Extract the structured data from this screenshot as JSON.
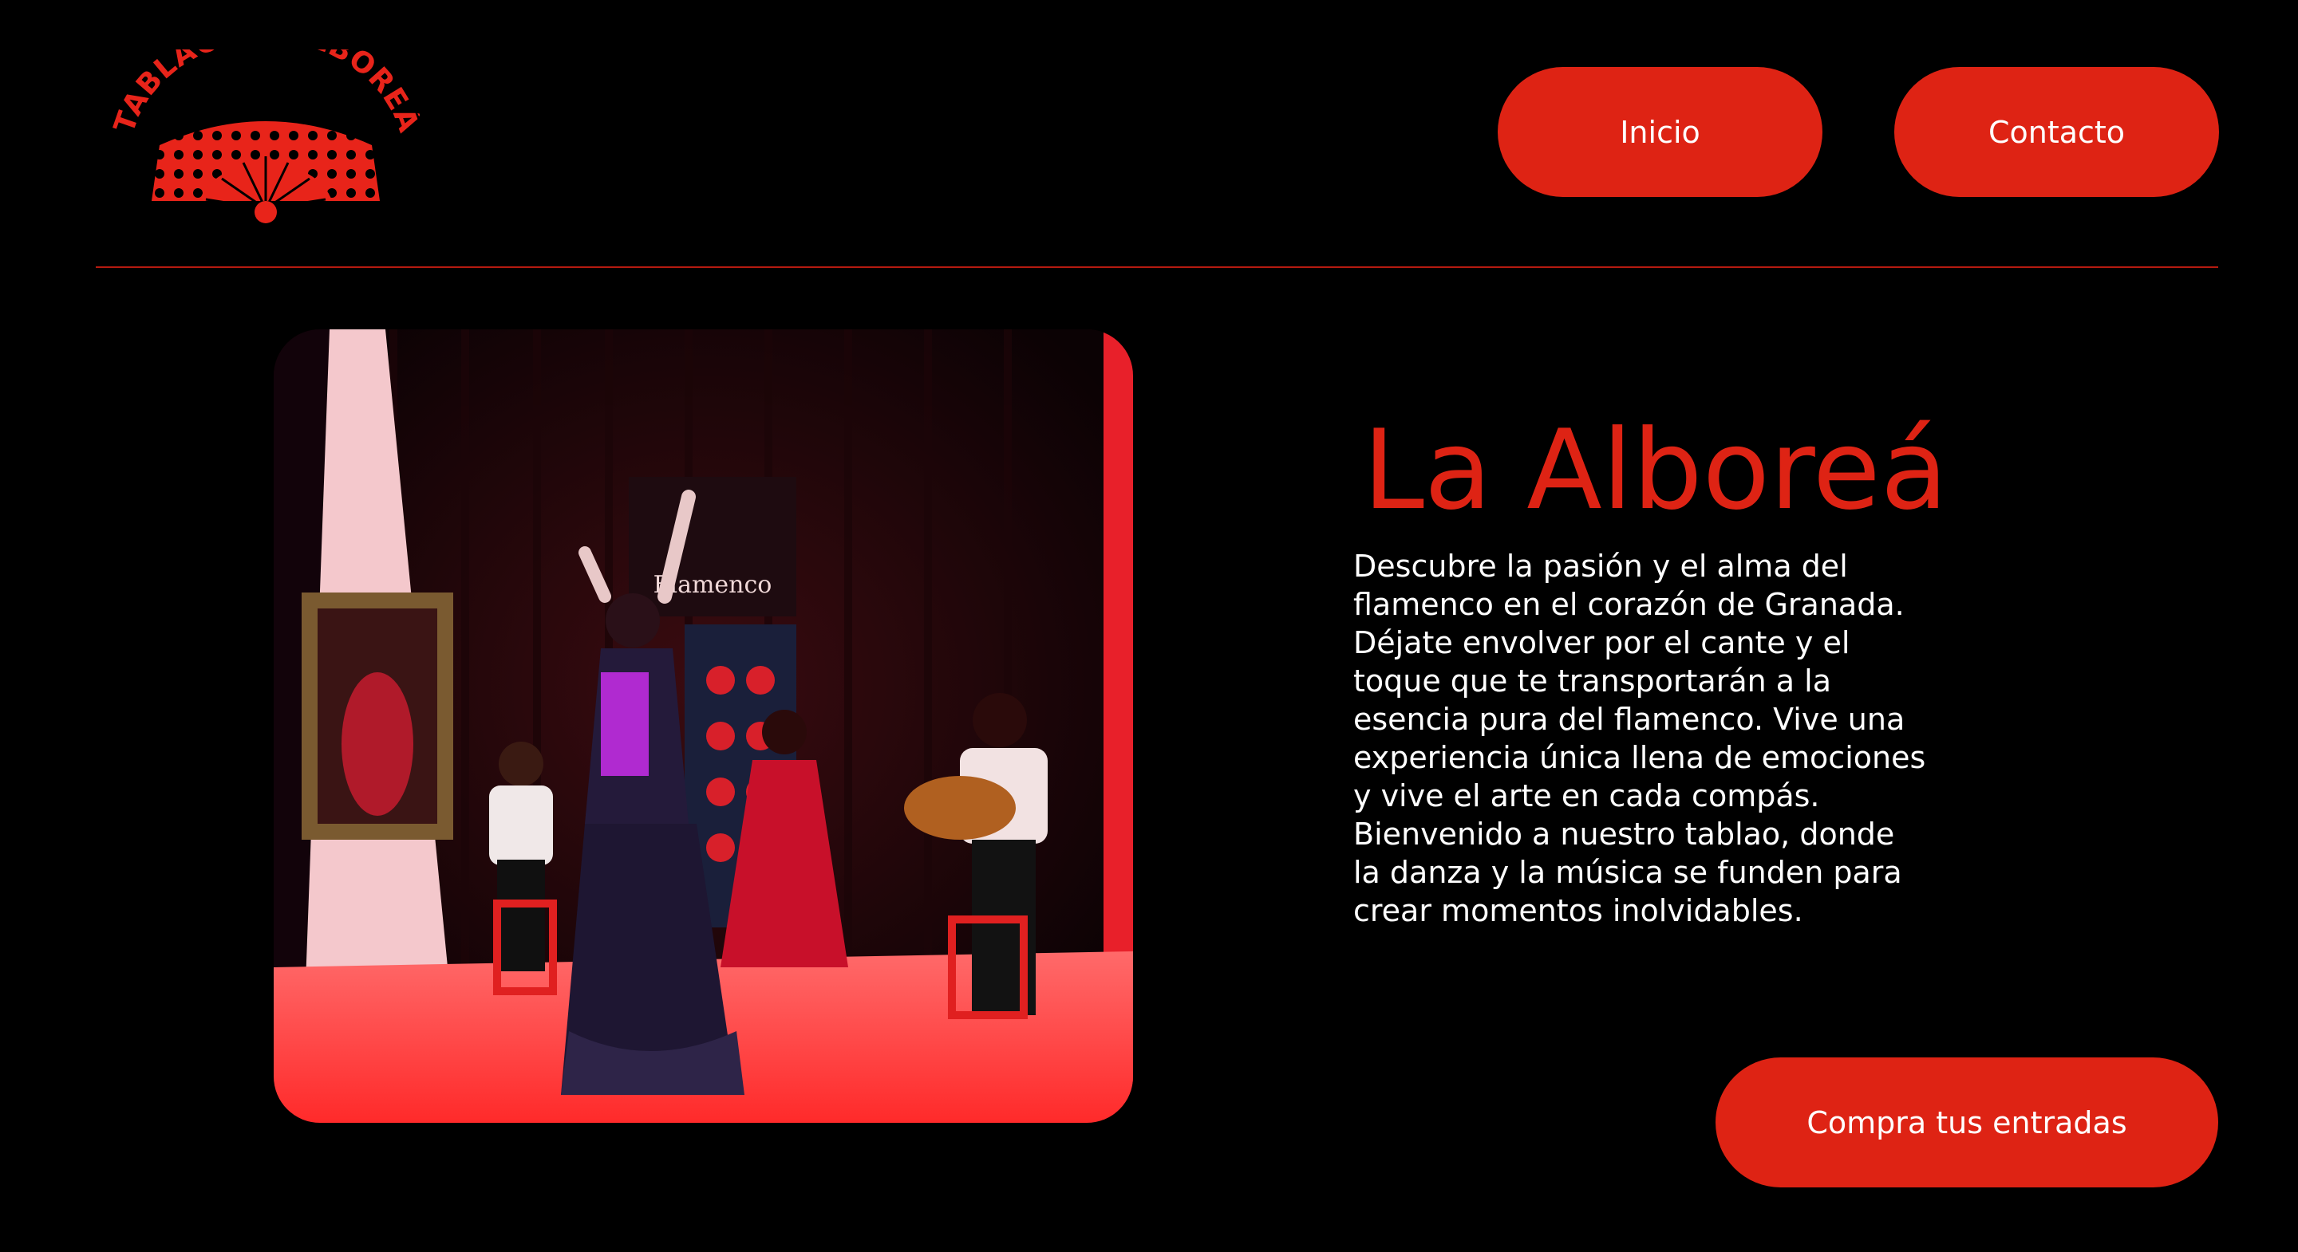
{
  "logo": {
    "text": "TABLAO LA ALBOREÁ",
    "icon": "fan-icon",
    "color": "#de2314"
  },
  "nav": {
    "items": [
      {
        "label": "Inicio"
      },
      {
        "label": "Contacto"
      }
    ]
  },
  "hero": {
    "title": "La Alboreá",
    "description": "Descubre la pasión y el alma del flamenco en el corazón de Granada. Déjate envolver por el cante y el toque que te transportarán a la esencia pura del flamenco. Vive una experiencia única llena de emociones y vive el arte en cada compás. Bienvenido a nuestro tablao, donde la danza y la música se funden para crear momentos inolvidables.",
    "cta_label": "Compra tus entradas",
    "photo_banner": "Flamenco"
  },
  "colors": {
    "accent": "#de2314",
    "background": "#000000",
    "text": "#ffffff"
  }
}
